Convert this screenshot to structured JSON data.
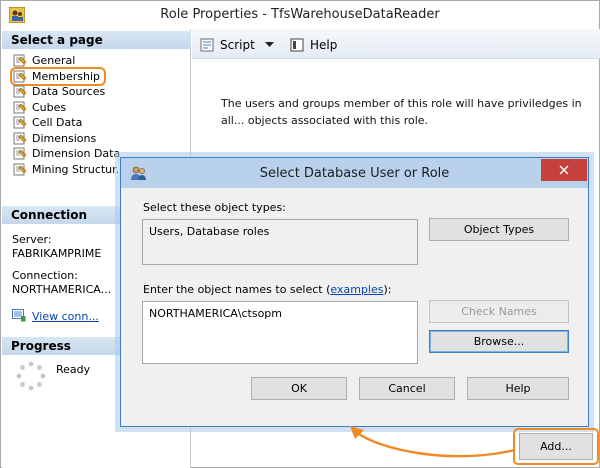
{
  "window": {
    "title": "Role Properties - TfsWarehouseDataReader"
  },
  "left_pane": {
    "select_page_header": "Select a page",
    "pages": [
      {
        "label": "General"
      },
      {
        "label": "Membership"
      },
      {
        "label": "Data Sources"
      },
      {
        "label": "Cubes"
      },
      {
        "label": "Cell Data"
      },
      {
        "label": "Dimensions"
      },
      {
        "label": "Dimension Data"
      },
      {
        "label": "Mining Structur..."
      }
    ],
    "connection_header": "Connection",
    "server_label": "Server:",
    "server_value": "FABRIKAMPRIME",
    "connection_label": "Connection:",
    "connection_value": "NORTHAMERICA...",
    "view_connection_link": "View conn...",
    "progress_header": "Progress",
    "progress_status": "Ready"
  },
  "toolbar": {
    "script_label": "Script",
    "help_label": "Help"
  },
  "main": {
    "description": "The users and groups member of this role will have priviledges in all... objects associated with this role."
  },
  "dialog": {
    "title": "Select Database User or Role",
    "object_types_label": "Select these object types:",
    "object_types_value": "Users, Database roles",
    "object_types_button": "Object Types",
    "names_label_prefix": "Enter the object names to select (",
    "names_label_link": "examples",
    "names_label_suffix": "):",
    "names_value": "NORTHAMERICA\\ctsopm",
    "check_names_button": "Check Names",
    "browse_button": "Browse...",
    "ok_button": "OK",
    "cancel_button": "Cancel",
    "help_button": "Help"
  },
  "add_button": "Add...",
  "colors": {
    "highlight": "#f08a24",
    "dialog_title_bg": "#b9d1ea",
    "close_button": "#c7413c",
    "link": "#0645ad"
  }
}
